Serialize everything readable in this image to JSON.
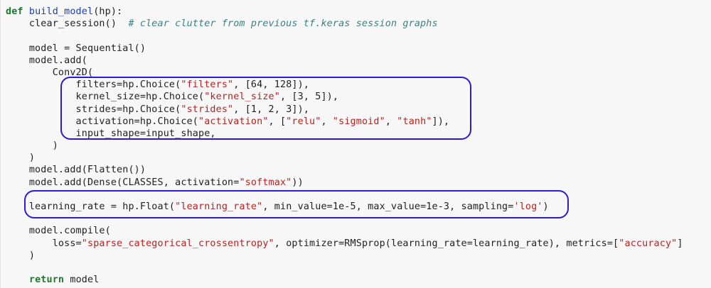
{
  "code_cell": {
    "lines": [
      [
        {
          "t": "def",
          "c": "kw"
        },
        {
          "t": " "
        },
        {
          "t": "build_model",
          "c": "fn"
        },
        {
          "t": "(hp):"
        }
      ],
      [
        {
          "t": "    clear_session()  "
        },
        {
          "t": "# clear clutter from previous tf.keras session graphs",
          "c": "cm"
        }
      ],
      [
        {
          "t": ""
        }
      ],
      [
        {
          "t": "    model = Sequential()"
        }
      ],
      [
        {
          "t": "    model.add("
        }
      ],
      [
        {
          "t": "        Conv2D("
        }
      ],
      [
        {
          "t": "            filters=hp.Choice("
        },
        {
          "t": "\"filters\"",
          "c": "st"
        },
        {
          "t": ", [64, 128]),"
        }
      ],
      [
        {
          "t": "            kernel_size=hp.Choice("
        },
        {
          "t": "\"kernel_size\"",
          "c": "st"
        },
        {
          "t": ", [3, 5]),"
        }
      ],
      [
        {
          "t": "            strides=hp.Choice("
        },
        {
          "t": "\"strides\"",
          "c": "st"
        },
        {
          "t": ", [1, 2, 3]),"
        }
      ],
      [
        {
          "t": "            activation=hp.Choice("
        },
        {
          "t": "\"activation\"",
          "c": "st"
        },
        {
          "t": ", ["
        },
        {
          "t": "\"relu\"",
          "c": "st"
        },
        {
          "t": ", "
        },
        {
          "t": "\"sigmoid\"",
          "c": "st"
        },
        {
          "t": ", "
        },
        {
          "t": "\"tanh\"",
          "c": "st"
        },
        {
          "t": "]),"
        }
      ],
      [
        {
          "t": "            input_shape=input_shape,"
        }
      ],
      [
        {
          "t": "        )"
        }
      ],
      [
        {
          "t": "    )"
        }
      ],
      [
        {
          "t": "    model.add(Flatten())"
        }
      ],
      [
        {
          "t": "    model.add(Dense(CLASSES, activation="
        },
        {
          "t": "\"softmax\"",
          "c": "st"
        },
        {
          "t": "))"
        }
      ],
      [
        {
          "t": ""
        }
      ],
      [
        {
          "t": "    learning_rate = hp.Float("
        },
        {
          "t": "\"learning_rate\"",
          "c": "st"
        },
        {
          "t": ", min_value=1e-5, max_value=1e-3, sampling="
        },
        {
          "t": "'log'",
          "c": "st"
        },
        {
          "t": ")"
        }
      ],
      [
        {
          "t": ""
        }
      ],
      [
        {
          "t": "    model.compile("
        }
      ],
      [
        {
          "t": "        loss="
        },
        {
          "t": "\"sparse_categorical_crossentropy\"",
          "c": "st"
        },
        {
          "t": ", optimizer=RMSprop(learning_rate=learning_rate), metrics=["
        },
        {
          "t": "\"accuracy\"",
          "c": "st"
        },
        {
          "t": "]"
        }
      ],
      [
        {
          "t": "    )"
        }
      ],
      [
        {
          "t": ""
        }
      ],
      [
        {
          "t": "    "
        },
        {
          "t": "return",
          "c": "kw"
        },
        {
          "t": " model"
        }
      ]
    ]
  },
  "annotations": {
    "color": "#2b1ad6",
    "highlights": [
      "hp-choice-params-highlight",
      "learning-rate-highlight"
    ]
  }
}
